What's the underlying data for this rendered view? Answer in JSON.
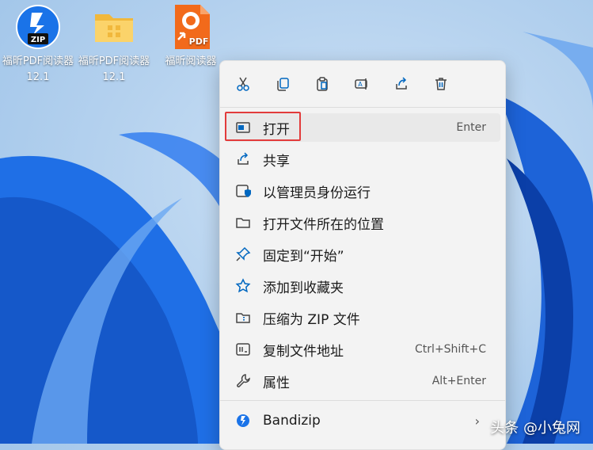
{
  "desktop": {
    "icons": [
      {
        "label": "福昕PDF阅读器 12.1",
        "icon": "zip-app-icon"
      },
      {
        "label": "福昕PDF阅读器 12.1",
        "icon": "folder-icon"
      },
      {
        "label": "福昕阅读器",
        "icon": "foxit-pdf-icon",
        "badge": "PDF"
      }
    ],
    "zip_badge": "ZIP"
  },
  "context_menu": {
    "toolbar": [
      "cut-icon",
      "copy-icon",
      "paste-icon",
      "rename-icon",
      "share-icon",
      "delete-icon"
    ],
    "items": [
      {
        "label": "打开",
        "shortcut": "Enter",
        "icon": "open-icon"
      },
      {
        "label": "共享",
        "shortcut": "",
        "icon": "share-icon"
      },
      {
        "label": "以管理员身份运行",
        "shortcut": "",
        "icon": "admin-shield-icon"
      },
      {
        "label": "打开文件所在的位置",
        "shortcut": "",
        "icon": "folder-open-icon"
      },
      {
        "label": "固定到“开始”",
        "shortcut": "",
        "icon": "pin-icon"
      },
      {
        "label": "添加到收藏夹",
        "shortcut": "",
        "icon": "star-icon"
      },
      {
        "label": "压缩为 ZIP 文件",
        "shortcut": "",
        "icon": "zip-folder-icon"
      },
      {
        "label": "复制文件地址",
        "shortcut": "Ctrl+Shift+C",
        "icon": "copy-path-icon"
      },
      {
        "label": "属性",
        "shortcut": "Alt+Enter",
        "icon": "wrench-icon"
      }
    ],
    "bandizip": {
      "label": "Bandizip",
      "icon": "bandizip-icon"
    }
  },
  "watermark": "头条 @小兔网",
  "colors": {
    "accent": "#0067c0",
    "highlight_border": "#e23b3b"
  }
}
